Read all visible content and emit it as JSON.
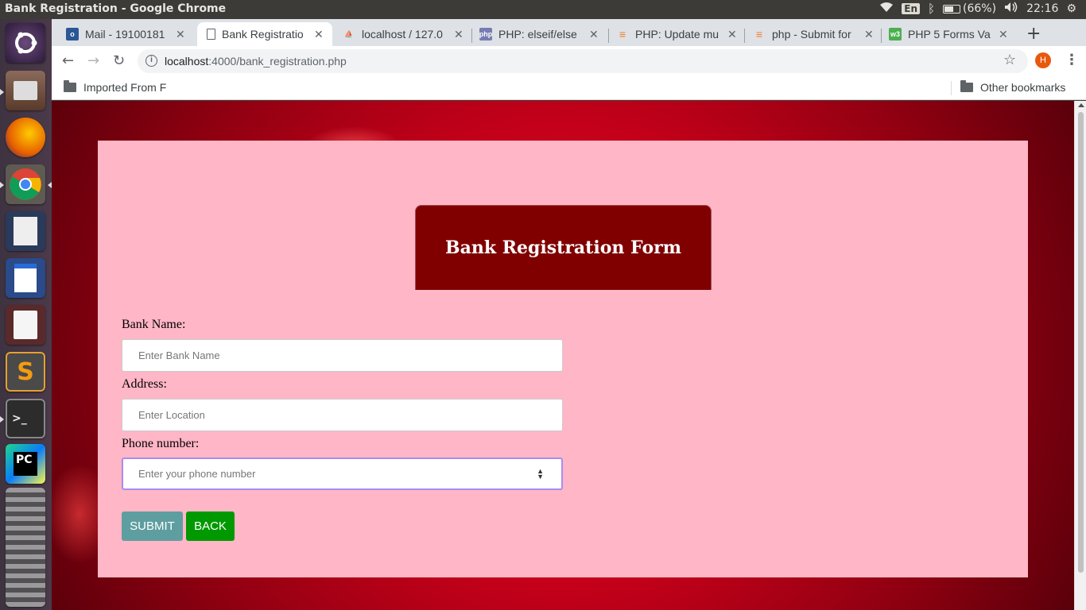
{
  "system": {
    "window_title": "Bank Registration - Google Chrome",
    "keyboard": "En",
    "battery": "(66%)",
    "battery_fraction": 0.66,
    "time": "22:16"
  },
  "tabs": [
    {
      "title": "Mail - 19100181",
      "icon": "outlook-icon",
      "color": "#2b5797",
      "active": false
    },
    {
      "title": "Bank Registratio",
      "icon": "page-icon",
      "color": "#ffffff",
      "active": true
    },
    {
      "title": "localhost / 127.0",
      "icon": "phpmyadmin-icon",
      "color": "#f5a623",
      "active": false
    },
    {
      "title": "PHP: elseif/else",
      "icon": "php-icon",
      "color": "#777bb3",
      "active": false
    },
    {
      "title": "PHP: Update mu",
      "icon": "stackoverflow-icon",
      "color": "#f48024",
      "active": false
    },
    {
      "title": "php - Submit for",
      "icon": "stackoverflow-icon",
      "color": "#f48024",
      "active": false
    },
    {
      "title": "PHP 5 Forms Va",
      "icon": "w3schools-icon",
      "color": "#4caf50",
      "active": false
    }
  ],
  "address_bar": {
    "host": "localhost",
    "rest": ":4000/bank_registration.php"
  },
  "profile_initial": "H",
  "bookmarks": {
    "left": "Imported From F",
    "right": "Other bookmarks"
  },
  "form": {
    "title": "Bank Registration Form",
    "bank_name_label": "Bank Name:",
    "bank_name_placeholder": "Enter Bank Name",
    "address_label": "Address:",
    "address_placeholder": "Enter Location",
    "phone_label": "Phone number:",
    "phone_placeholder": "Enter your phone number",
    "submit_label": "SUBMIT",
    "back_label": "BACK"
  },
  "colors": {
    "header_bg": "#800000",
    "form_bg": "#ffb6c6",
    "submit_bg": "#5f9ea0",
    "back_bg": "#009900",
    "focus_border": "#a88cf0"
  },
  "launcher_icons": [
    "ubuntu-dash-icon",
    "files-icon",
    "firefox-icon",
    "chrome-icon",
    "text-editor-icon",
    "writer-icon",
    "document-viewer-icon",
    "sublime-text-icon",
    "terminal-icon",
    "pycharm-icon",
    "stacked-apps-icon"
  ]
}
